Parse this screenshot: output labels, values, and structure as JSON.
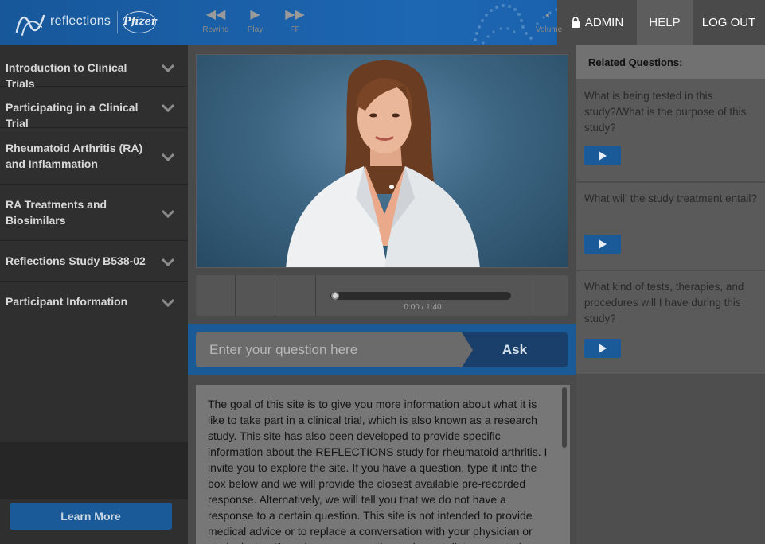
{
  "header": {
    "logo_text": "reflections",
    "partner_logo": "Pfizer",
    "nav": {
      "admin": "ADMIN",
      "help": "HELP",
      "logout": "LOG OUT"
    }
  },
  "sidebar": {
    "items": [
      {
        "label": "Introduction to Clinical Trials"
      },
      {
        "label": "Participating in a Clinical Trial"
      },
      {
        "label": "Rheumatoid Arthritis (RA) and Inflammation"
      },
      {
        "label": "RA Treatments and Biosimilars"
      },
      {
        "label": "Reflections Study B538-02"
      },
      {
        "label": "Participant Information"
      }
    ],
    "learn_more": "Learn More"
  },
  "player": {
    "rewind": "Rewind",
    "play": "Play",
    "ff": "FF",
    "volume": "Volume",
    "time": "0:00 / 1:40",
    "progress": 0
  },
  "ask": {
    "placeholder": "Enter your question here",
    "button": "Ask"
  },
  "info": {
    "text": "The goal of this site is to give you more information about what it is like to take part in a clinical trial, which is also known as a research study. This site has also been developed to provide specific information about the REFLECTIONS study for rheumatoid arthritis. I invite you to explore the site. If you have a question, type it into the box below and we will provide the closest available pre-recorded response. Alternatively, we will tell you that we do not have a response to a certain question. This site is not intended to provide medical advice or to replace a conversation with your physician or study doctor. If you have any questions, please talk to your study doctor."
  },
  "related": {
    "title": "Related Questions:",
    "questions": [
      {
        "text": "What is being tested in this study?/What is the purpose of this study?"
      },
      {
        "text": "What will the study treatment entail?"
      },
      {
        "text": "What kind of tests, therapies, and procedures will I have during this study?"
      }
    ]
  },
  "colors": {
    "header_blue": "#1d66b2",
    "accent_blue": "#1a5a98",
    "ask_button": "#1a3f6a"
  }
}
